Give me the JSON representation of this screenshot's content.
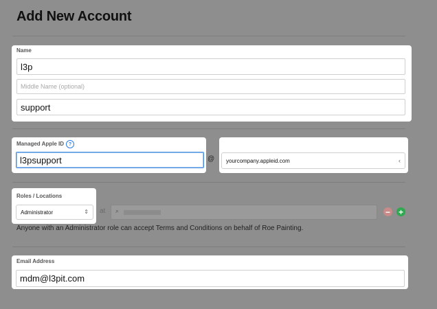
{
  "page": {
    "title": "Add New Account"
  },
  "name_section": {
    "label": "Name",
    "first_name": "l3p",
    "middle_placeholder": "Middle Name (optional)",
    "last_name": "support"
  },
  "apple_id_section": {
    "label": "Managed Apple ID",
    "help_icon": "question-circle-icon",
    "username": "l3psupport",
    "at_symbol": "@",
    "domain": "yourcompany.appleid.com"
  },
  "roles_section": {
    "label": "Roles / Locations",
    "role": "Administrator",
    "at_label": "at",
    "location_icon": "search-icon",
    "remove_icon": "minus-circle-icon",
    "add_icon": "plus-circle-icon",
    "note": "Anyone with an Administrator role can accept Terms and Conditions on behalf of Roe Painting."
  },
  "email_section": {
    "label": "Email Address",
    "email": "mdm@l3pit.com"
  },
  "colors": {
    "overlay": "#8e8e8e",
    "focus_blue": "#4a90e2",
    "add_green": "#2fa84f",
    "remove_red": "#c98a8a"
  }
}
